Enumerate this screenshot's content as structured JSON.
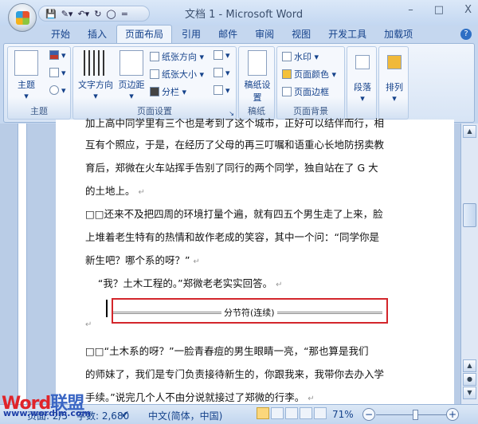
{
  "window": {
    "title": "文档 1 - Microsoft Word",
    "minimize": "–",
    "maximize": "□",
    "close": "X"
  },
  "qat": {
    "customize": "="
  },
  "tabs": [
    "开始",
    "插入",
    "页面布局",
    "引用",
    "邮件",
    "审阅",
    "视图",
    "开发工具",
    "加载项"
  ],
  "help": "?",
  "ribbon": {
    "theme": {
      "label": "主题",
      "themes": "主题",
      "group": "主题"
    },
    "page_setup": {
      "text_direction": "文字方向",
      "margins": "页边距",
      "orientation": "纸张方向",
      "size": "纸张大小",
      "columns": "分栏",
      "group": "页面设置"
    },
    "manuscript": {
      "setup": "稿纸设置",
      "group": "稿纸"
    },
    "background": {
      "watermark": "水印",
      "page_color": "页面颜色",
      "page_borders": "页面边框",
      "group": "页面背景"
    },
    "paragraph": {
      "label": "段落"
    },
    "arrange": {
      "label": "排列"
    }
  },
  "document": {
    "lines": [
      "加上高中同学里有三个也是考到了这个城市，正好可以结伴而行，相",
      "互有个照应，于是，在经历了父母的再三叮嘱和语重心长地防拐卖教",
      "育后，郑微在火车站挥手告别了同行的两个同学，独自站在了 G 大",
      "的土地上。",
      "□□还来不及把四周的环境打量个遍，就有四五个男生走了上来，脸",
      "上堆着老生特有的热情和故作老成的笑容，其中一个问：“同学你是",
      "新生吧？哪个系的呀？”",
      "    “我？土木工程的。”郑微老老实实回答。",
      "",
      "□□“土木系的呀？”一脸青春痘的男生眼睛一亮，“那也算是我们",
      "的师妹了，我们是专门负责接待新生的，你跟我来，我带你去办入学",
      "手续。”说完几个人不由分说就接过了郑微的行李。"
    ],
    "section_break": "分节符(连续)",
    "para_mark": "↵"
  },
  "status": {
    "page": "页面: 2/5",
    "words": "字数: 2,680",
    "language": "中文(简体，中国)",
    "zoom": "71%",
    "zoom_value": 71
  },
  "watermark": {
    "brand1": "Word",
    "brand2": "联盟",
    "url": "www.wordlm.com"
  },
  "colors": {
    "highlight": "#d3262b",
    "accent": "#15428b"
  }
}
